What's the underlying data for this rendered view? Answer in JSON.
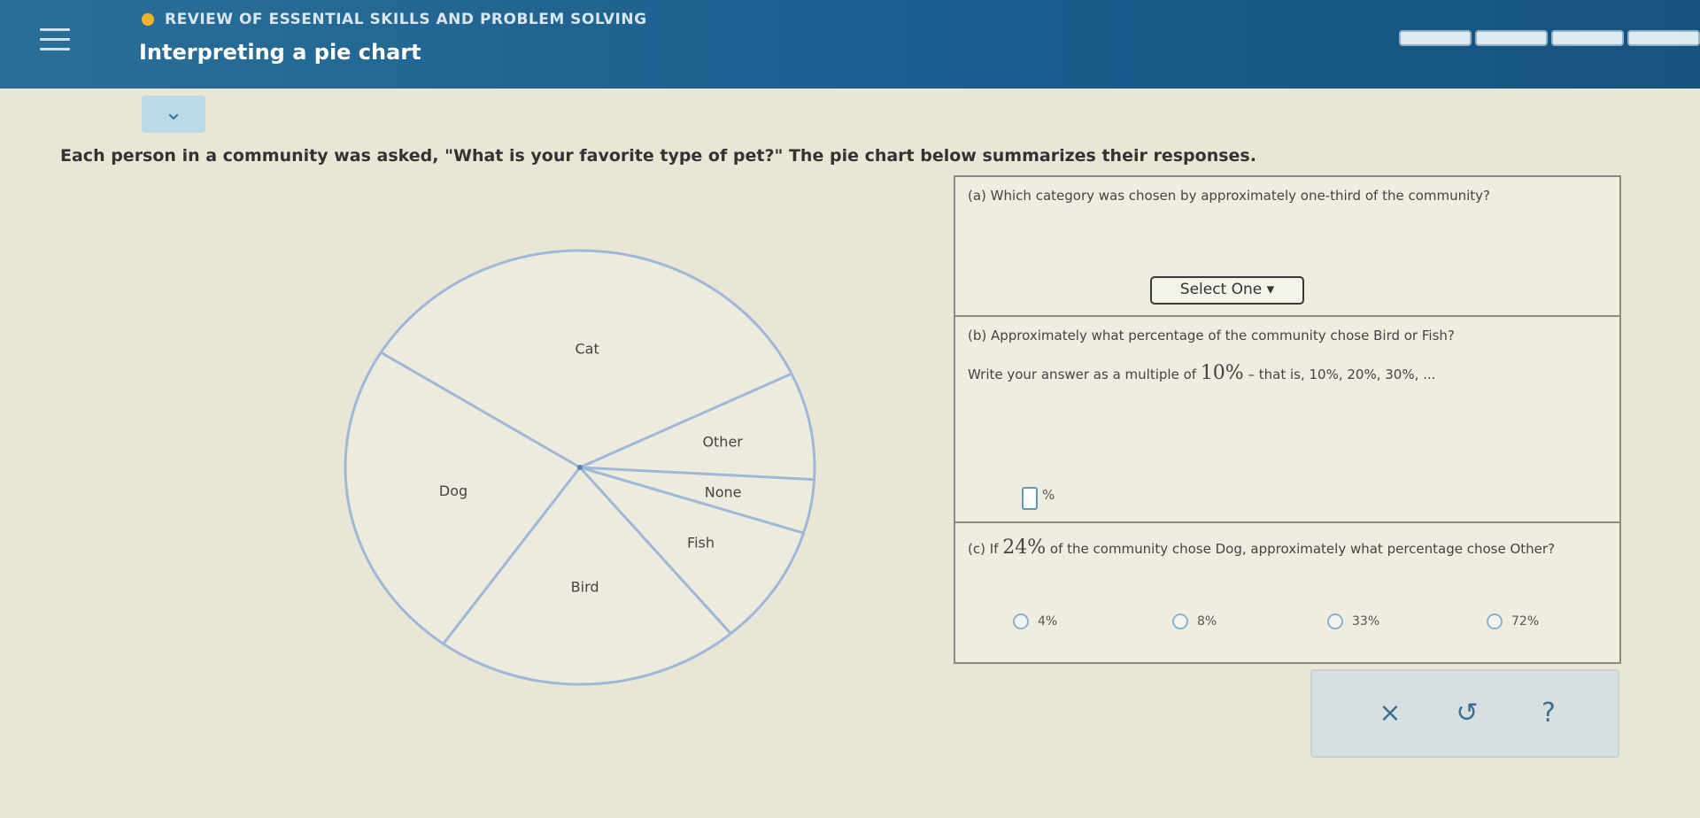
{
  "header": {
    "section": "REVIEW OF ESSENTIAL SKILLS AND PROBLEM SOLVING",
    "title": "Interpreting a pie chart"
  },
  "prompt": "Each person in a community was asked, \"What is your favorite type of pet?\" The pie chart below summarizes their responses.",
  "chart_data": {
    "type": "pie",
    "title": "",
    "categories": [
      "Cat",
      "Other",
      "None",
      "Fish",
      "Bird",
      "Dog"
    ],
    "values": [
      34,
      8,
      4,
      9,
      21,
      24
    ]
  },
  "questions": {
    "a": {
      "text": "(a) Which category was chosen by approximately one-third of the community?",
      "select_label": "Select One"
    },
    "b": {
      "text": "(b) Approximately what percentage of the community chose Bird or Fish?",
      "instruction_pre": "Write your answer as a multiple of",
      "instruction_value": "10%",
      "instruction_post": "– that is, 10%, 20%, 30%, ...",
      "unit": "%"
    },
    "c": {
      "text_pre": "(c) If",
      "text_value": "24%",
      "text_post": "of the community chose Dog, approximately what percentage chose Other?",
      "choices": [
        "4%",
        "8%",
        "33%",
        "72%"
      ]
    }
  },
  "actions": {
    "clear": "×",
    "undo": "↺",
    "help": "?"
  },
  "colors": {
    "header": "#1b5d8d",
    "pie_line": "#9fb8d8"
  }
}
